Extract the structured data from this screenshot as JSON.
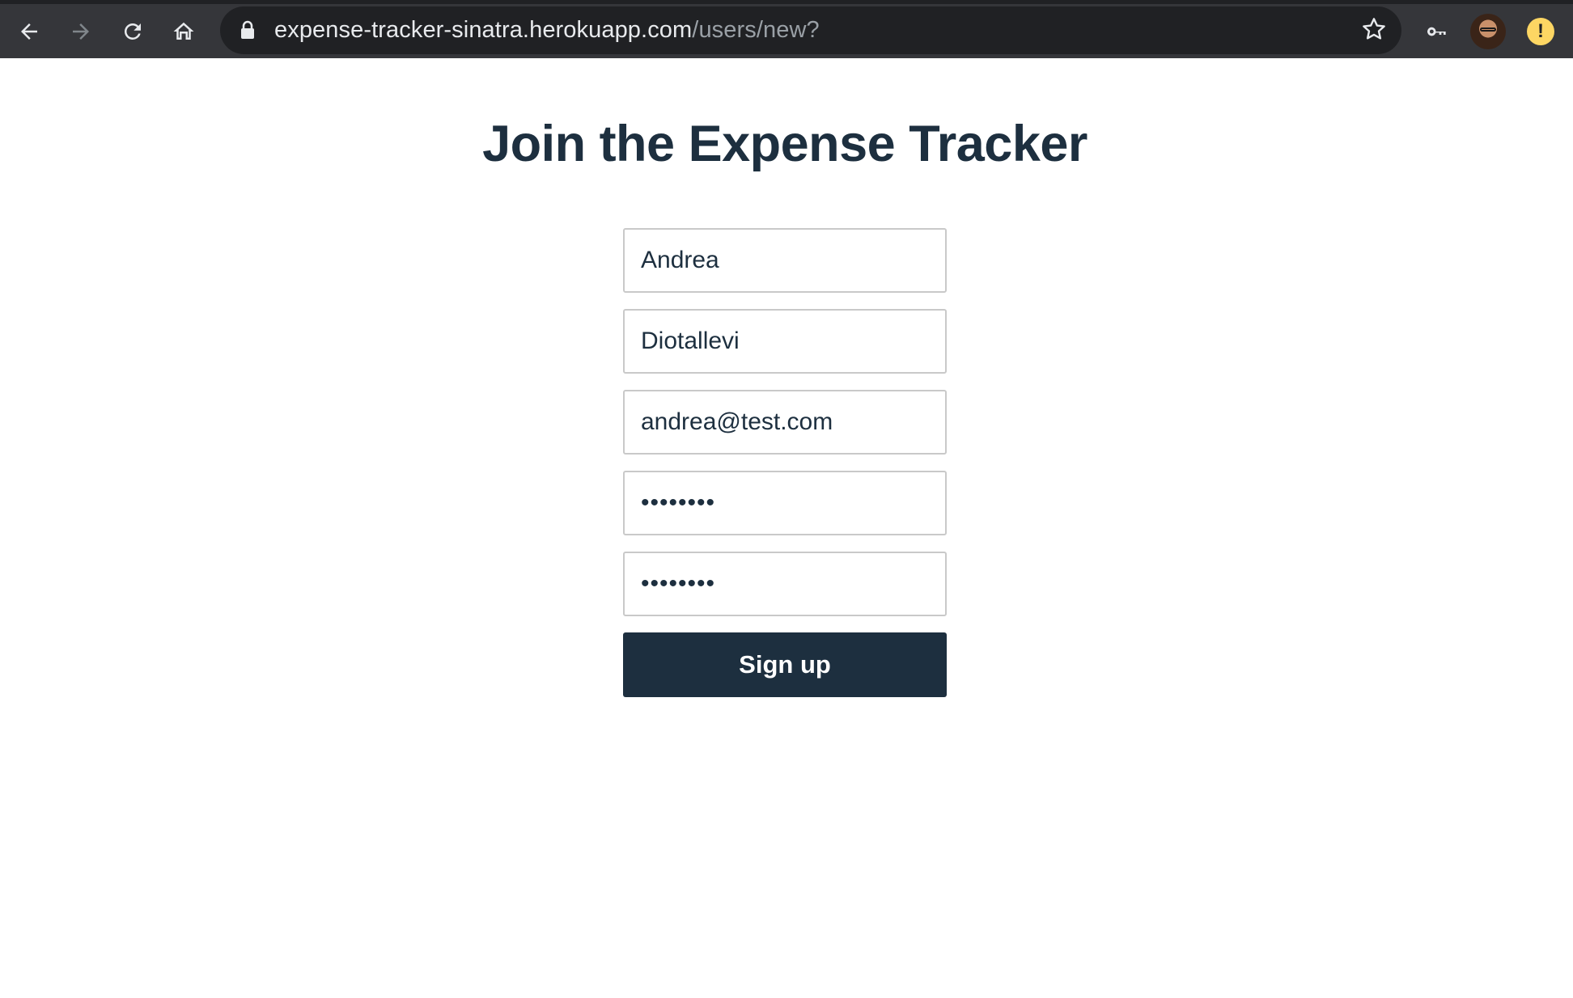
{
  "browser": {
    "url_host": "expense-tracker-sinatra.herokuapp.com",
    "url_path": "/users/new?"
  },
  "page": {
    "title": "Join the Expense Tracker"
  },
  "form": {
    "first_name": "Andrea",
    "last_name": "Diotallevi",
    "email": "andrea@test.com",
    "password": "••••••••",
    "password_confirmation": "••••••••",
    "submit_label": "Sign up"
  },
  "colors": {
    "brand_dark": "#1d2f3f",
    "browser_chrome": "#35363a",
    "field_border": "#c9c9c9",
    "warning": "#fdd663"
  }
}
